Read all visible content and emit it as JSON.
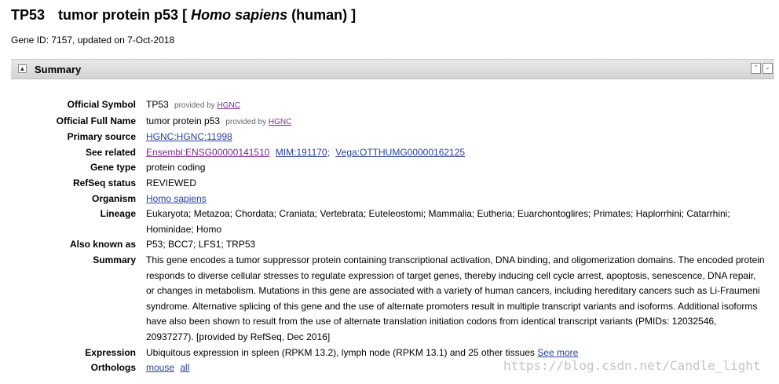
{
  "header": {
    "symbol": "TP53",
    "name": "tumor protein p53",
    "bracket_open": "[",
    "organism_italic": "Homo sapiens",
    "organism_common": "(human)",
    "bracket_close": "]",
    "gene_info": "Gene ID: 7157, updated on 7-Oct-2018"
  },
  "section": {
    "title": "Summary",
    "toggle_glyph": "▲",
    "nav_top_glyph": "⌃",
    "nav_bottom_glyph": "⌄"
  },
  "props": {
    "official_symbol": {
      "label": "Official Symbol",
      "value": "TP53",
      "provided": "provided by",
      "provider": "HGNC"
    },
    "official_full_name": {
      "label": "Official Full Name",
      "value": "tumor protein p53",
      "provided": "provided by",
      "provider": "HGNC"
    },
    "primary_source": {
      "label": "Primary source",
      "link": "HGNC:HGNC:11998"
    },
    "see_related": {
      "label": "See related",
      "links": [
        "Ensembl:ENSG00000141510",
        "MIM:191170;",
        "Vega:OTTHUMG00000162125"
      ]
    },
    "gene_type": {
      "label": "Gene type",
      "value": "protein coding"
    },
    "refseq_status": {
      "label": "RefSeq status",
      "value": "REVIEWED"
    },
    "organism": {
      "label": "Organism",
      "link": "Homo sapiens"
    },
    "lineage": {
      "label": "Lineage",
      "value": "Eukaryota; Metazoa; Chordata; Craniata; Vertebrata; Euteleostomi; Mammalia; Eutheria; Euarchontoglires; Primates; Haplorrhini; Catarrhini; Hominidae; Homo"
    },
    "also_known_as": {
      "label": "Also known as",
      "value": "P53; BCC7; LFS1; TRP53"
    },
    "summary": {
      "label": "Summary",
      "value": "This gene encodes a tumor suppressor protein containing transcriptional activation, DNA binding, and oligomerization domains. The encoded protein responds to diverse cellular stresses to regulate expression of target genes, thereby inducing cell cycle arrest, apoptosis, senescence, DNA repair, or changes in metabolism. Mutations in this gene are associated with a variety of human cancers, including hereditary cancers such as Li-Fraumeni syndrome. Alternative splicing of this gene and the use of alternate promoters result in multiple transcript variants and isoforms. Additional isoforms have also been shown to result from the use of alternate translation initiation codons from identical transcript variants (PMIDs: 12032546, 20937277). [provided by RefSeq, Dec 2016]"
    },
    "expression": {
      "label": "Expression",
      "value": "Ubiquitous expression in spleen (RPKM 13.2), lymph node (RPKM 13.1) and 25 other tissues",
      "link": "See more"
    },
    "orthologs": {
      "label": "Orthologs",
      "links": [
        "mouse",
        "all"
      ]
    }
  },
  "watermark": "https://blog.csdn.net/Candle_light",
  "colors": {
    "link": "#2a3f9b",
    "visited_link": "#7a2a8a",
    "bar": "#dcdcdc"
  }
}
